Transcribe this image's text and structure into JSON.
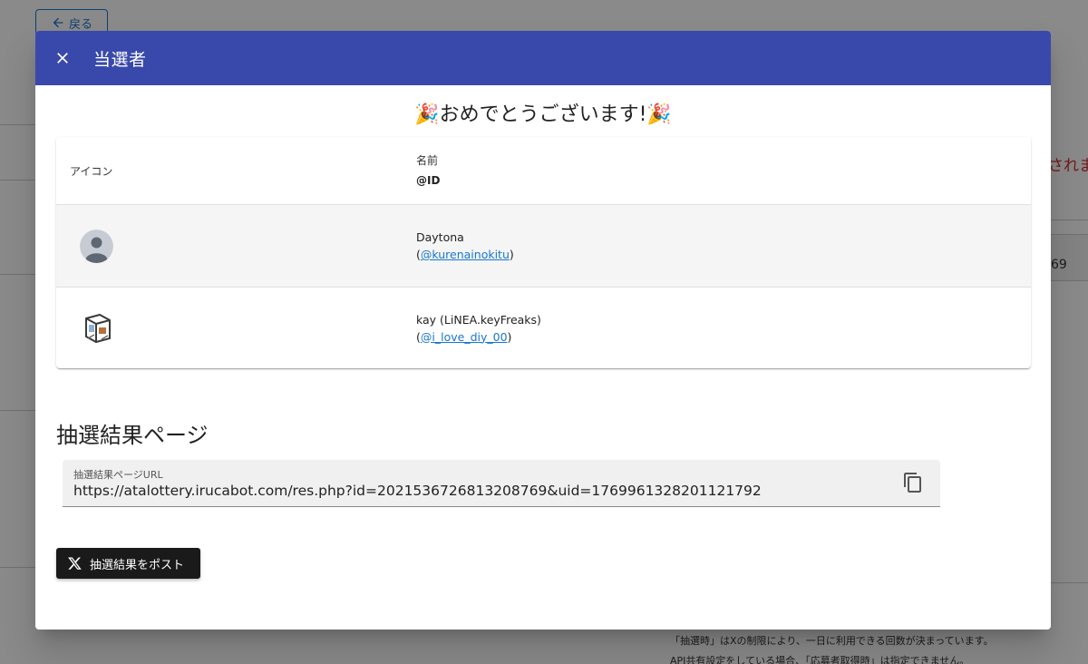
{
  "background": {
    "back_label": "戻る",
    "right_red_text": "されま",
    "right_number": "69",
    "note_line_1": "「抽選時」はXの制限により、一日に利用できる回数が決まっています。",
    "note_line_2": "API共有設定をしている場合、「応募者取得時」は指定できません。"
  },
  "dialog": {
    "title": "当選者",
    "congrats": "🎉おめでとうございます!🎉",
    "table": {
      "header_icon": "アイコン",
      "header_name": "名前",
      "header_id": "@ID",
      "rows": [
        {
          "name": "Daytona",
          "paren_open": "(",
          "handle": "@kurenainokitu",
          "paren_close": ")"
        },
        {
          "name": "kay (LiNEA.keyFreaks)",
          "paren_open": "(",
          "handle": "@i_love_diy_00",
          "paren_close": ")"
        }
      ]
    },
    "result_section_title": "抽選結果ページ",
    "url_field": {
      "label": "抽選結果ページURL",
      "value": "https://atalottery.irucabot.com/res.php?id=2021536726813208769&uid=1769961328201121792"
    },
    "post_button_label": "抽選結果をポスト"
  },
  "icons": {
    "close": "close-icon",
    "copy": "copy-icon",
    "x_logo": "x-logo-icon",
    "default_avatar": "default-avatar-icon",
    "back_arrow": "arrow-left-icon"
  },
  "colors": {
    "toolbar": "#3949ab",
    "link": "#1976d2",
    "post_button": "#1a1a1a"
  }
}
